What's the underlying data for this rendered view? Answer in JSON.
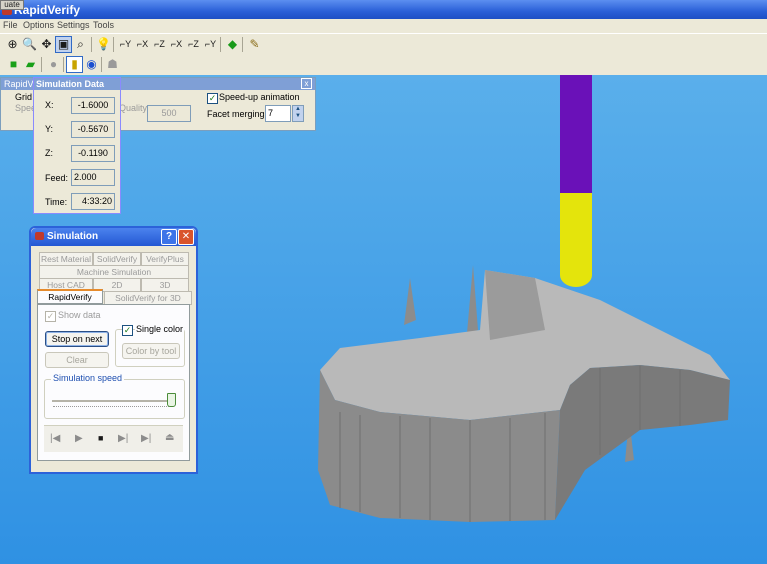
{
  "window": {
    "title": "RapidVerify",
    "eval_tab": "uate"
  },
  "menu": [
    "File",
    "Options",
    "Settings",
    "Tools"
  ],
  "toolbar1_icons": [
    "select-icon",
    "zoom-window-icon",
    "pan-icon",
    "zoom-fit-icon",
    "zoom-icon",
    "light-bulb-icon",
    "view-xy-icon",
    "view-yx-icon",
    "view-xz-icon",
    "view-zx-icon",
    "view-yz-icon",
    "view-zy-icon",
    "stock-cube-icon",
    "eraser-icon"
  ],
  "toolbar2_icons": [
    "green-stock-icon",
    "green-stock-multi-icon",
    "gray-circle-icon",
    "tool-yellow-icon",
    "tool-blue-icon",
    "gray-person-icon"
  ],
  "settings_panel": {
    "title": "RapidVerify",
    "grid_label": "Grid R",
    "speed_label": "Speed",
    "quality_label": "Quality",
    "quality_value": "500",
    "speedup_label": "Speed-up animation",
    "speedup_checked": true,
    "facet_label": "Facet merging:",
    "facet_value": "7",
    "close": "x"
  },
  "sim_data": {
    "title": "Simulation Data",
    "x_label": "X:",
    "x": "-1.6000",
    "y_label": "Y:",
    "y": "-0.5670",
    "z_label": "Z:",
    "z": "-0.1190",
    "feed_label": "Feed:",
    "feed": "2.000",
    "time_label": "Time:",
    "time": "4:33:20"
  },
  "simulation": {
    "title": "Simulation",
    "help": "?",
    "close": "✕",
    "tabs_row1": [
      "Rest Material",
      "SolidVerify",
      "VerifyPlus"
    ],
    "tabs_row2": [
      "Machine Simulation"
    ],
    "tabs_row3": [
      "Host CAD",
      "2D",
      "3D"
    ],
    "tabs_row4": [
      "RapidVerify",
      "SolidVerify for 3D"
    ],
    "show_data": "Show data",
    "stop_on_next": "Stop on next",
    "single_color": "Single color",
    "clear": "Clear",
    "color_by_tool": "Color by tool",
    "speed_group": "Simulation speed",
    "speed_value": 1.0,
    "play_icons": [
      "step-back-icon",
      "play-icon",
      "stop-icon",
      "step-forward-icon",
      "end-icon",
      "eject-icon"
    ]
  },
  "colors": {
    "tool_holder": "#6a11b8",
    "tool_tip": "#e4e40c",
    "stock": "#8a8a8a",
    "background": "#3d9be6"
  }
}
